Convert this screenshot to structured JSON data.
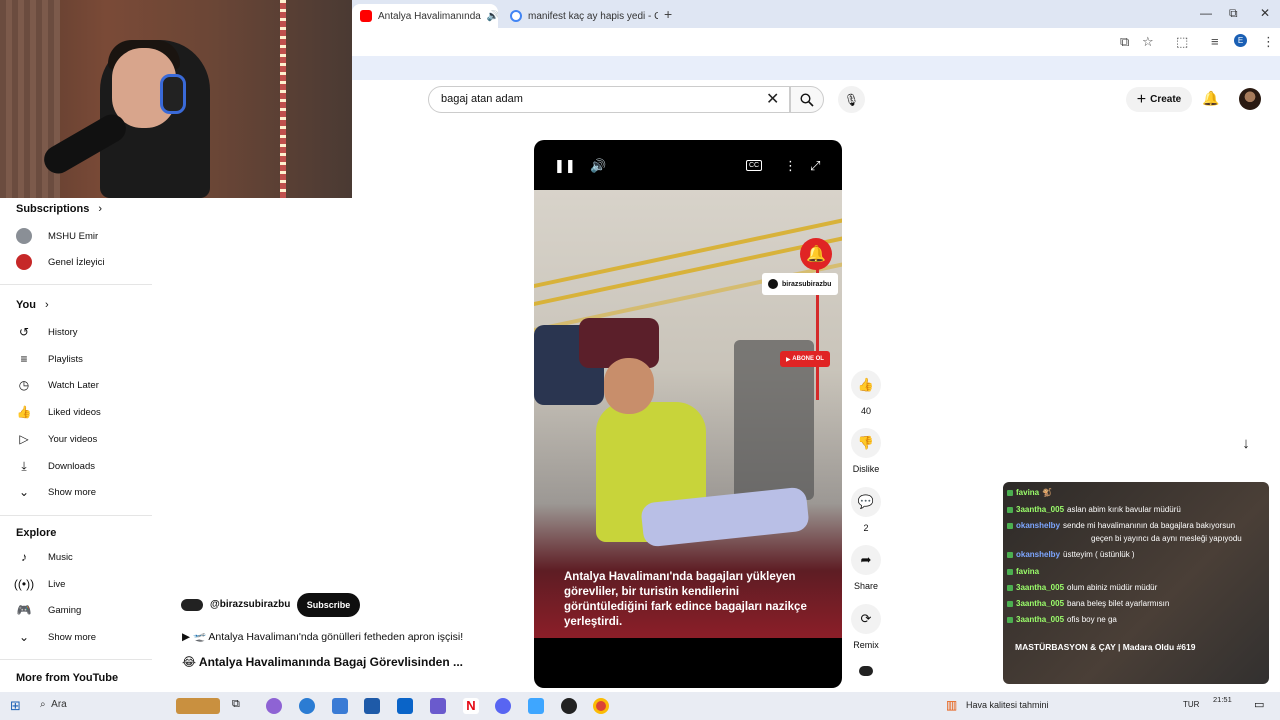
{
  "browser": {
    "tabs": [
      {
        "label": "Antalya Havalimanında",
        "active": true
      },
      {
        "label": "manifest kaç ay hapis yedi - Go",
        "active": false
      }
    ],
    "new_tab": "+",
    "win_controls": [
      "—",
      "⧉",
      "✕"
    ]
  },
  "header": {
    "search_value": "bagaj atan adam",
    "create_label": "Create"
  },
  "sidebar": {
    "subscriptions_title": "Subscriptions",
    "subscriptions": [
      {
        "label": "MSHU Emir",
        "color": "#8a8f96"
      },
      {
        "label": "Genel İzleyici",
        "color": "#c62828"
      }
    ],
    "you_title": "You",
    "you_items": [
      {
        "label": "History",
        "icon": "history-icon"
      },
      {
        "label": "Playlists",
        "icon": "playlists-icon"
      },
      {
        "label": "Watch Later",
        "icon": "watch-later-icon"
      },
      {
        "label": "Liked videos",
        "icon": "like-icon"
      },
      {
        "label": "Your videos",
        "icon": "your-videos-icon"
      },
      {
        "label": "Downloads",
        "icon": "download-icon"
      },
      {
        "label": "Show more",
        "icon": "chevron-down-icon"
      }
    ],
    "explore_title": "Explore",
    "explore_items": [
      {
        "label": "Music",
        "icon": "music-icon"
      },
      {
        "label": "Live",
        "icon": "live-icon"
      },
      {
        "label": "Gaming",
        "icon": "gaming-icon"
      },
      {
        "label": "Show more",
        "icon": "chevron-down-icon"
      }
    ],
    "more_title": "More from YouTube"
  },
  "video": {
    "channel_tag": "birazsubirazbu",
    "abone": "ABONE OL",
    "caption": "Antalya Havalimanı'nda bagajları yükleyen görevliler, bir turistin kendilerini görüntülediğini fark edince bagajları nazikçe yerleştirdi."
  },
  "actions": {
    "like_count": "40",
    "dislike_label": "Dislike",
    "comment_count": "2",
    "share_label": "Share",
    "remix_label": "Remix"
  },
  "channel": {
    "handle": "@birazsubirazbu",
    "subscribe_label": "Subscribe",
    "description": "▶ 🛫 Antalya Havalimanı'nda gönülleri fetheden apron işçisi!",
    "title": "😂 Antalya Havalimanında Bagaj Görevlisinden ..."
  },
  "chat": {
    "messages": [
      {
        "user": "favina",
        "text": "🐒",
        "color": "green"
      },
      {
        "user": "3aantha_005",
        "text": "aslan abim kırık bavular müdürü",
        "color": "green"
      },
      {
        "user": "okanshelby",
        "text": "sende mi havalimanının da bagajlara bakıyorsun",
        "color": "blue"
      },
      {
        "user": "",
        "text": "geçen bi yayıncı da aynı mesleği yapıyodu",
        "color": "green"
      },
      {
        "user": "okanshelby",
        "text": "üstteyim ( üstünlük )",
        "color": "blue"
      },
      {
        "user": "favina",
        "text": "",
        "color": "green"
      },
      {
        "user": "3aantha_005",
        "text": "olum abiniz müdür müdür",
        "color": "green"
      },
      {
        "user": "3aantha_005",
        "text": "bana beleş bilet ayarlarmısın",
        "color": "green"
      },
      {
        "user": "3aantha_005",
        "text": "ofis boy ne ga",
        "color": "green"
      }
    ],
    "stream_title": "MASTÜRBASYON & ÇAY | Madara Oldu #619"
  },
  "taskbar": {
    "search_label": "Ara",
    "weather": "Hava kalitesi tahmini",
    "lang": "TUR",
    "time": "21:51"
  }
}
